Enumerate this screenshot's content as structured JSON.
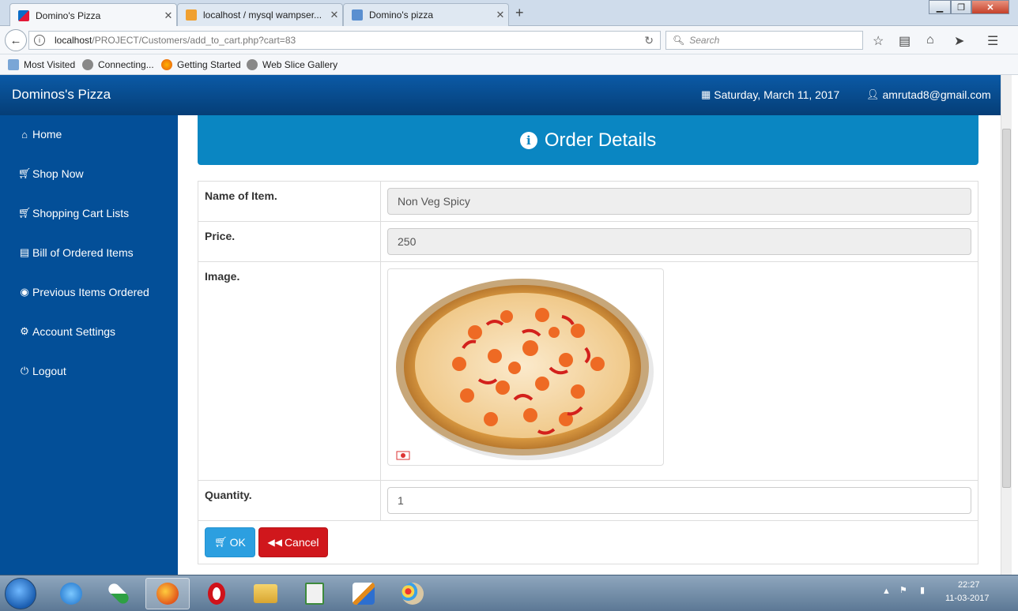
{
  "browser": {
    "tabs": [
      {
        "label": "Domino's Pizza",
        "active": true
      },
      {
        "label": "localhost / mysql wampser...",
        "active": false
      },
      {
        "label": "Domino's pizza",
        "active": false
      }
    ],
    "url_host": "localhost",
    "url_path": "/PROJECT/Customers/add_to_cart.php?cart=83",
    "search_placeholder": "Search",
    "bookmarks": [
      "Most Visited",
      "Connecting...",
      "Getting Started",
      "Web Slice Gallery"
    ]
  },
  "header": {
    "brand": "Dominos's Pizza",
    "date": "Saturday, March 11, 2017",
    "user": "amrutad8@gmail.com"
  },
  "sidebar": {
    "items": [
      {
        "label": "Home",
        "icon": "home-icon"
      },
      {
        "label": "Shop Now",
        "icon": "cart-icon"
      },
      {
        "label": "Shopping Cart Lists",
        "icon": "cart-icon"
      },
      {
        "label": "Bill of Ordered Items",
        "icon": "list-icon"
      },
      {
        "label": "Previous Items Ordered",
        "icon": "eye-icon"
      },
      {
        "label": "Account Settings",
        "icon": "gear-icon"
      },
      {
        "label": "Logout",
        "icon": "power-icon"
      }
    ]
  },
  "panel": {
    "title": "Order Details",
    "labels": {
      "name": "Name of Item.",
      "price": "Price.",
      "image": "Image.",
      "quantity": "Quantity."
    },
    "values": {
      "name": "Non Veg Spicy",
      "price": "250",
      "quantity": "1"
    },
    "ok_label": "OK",
    "cancel_label": "Cancel"
  },
  "taskbar": {
    "time": "22:27",
    "date": "11-03-2017"
  },
  "colors": {
    "header": "#0b5aa6",
    "sidebar": "#034f98",
    "panel_heading": "#0a86c2",
    "ok_button": "#2c9fe0",
    "cancel_button": "#d0171c"
  }
}
